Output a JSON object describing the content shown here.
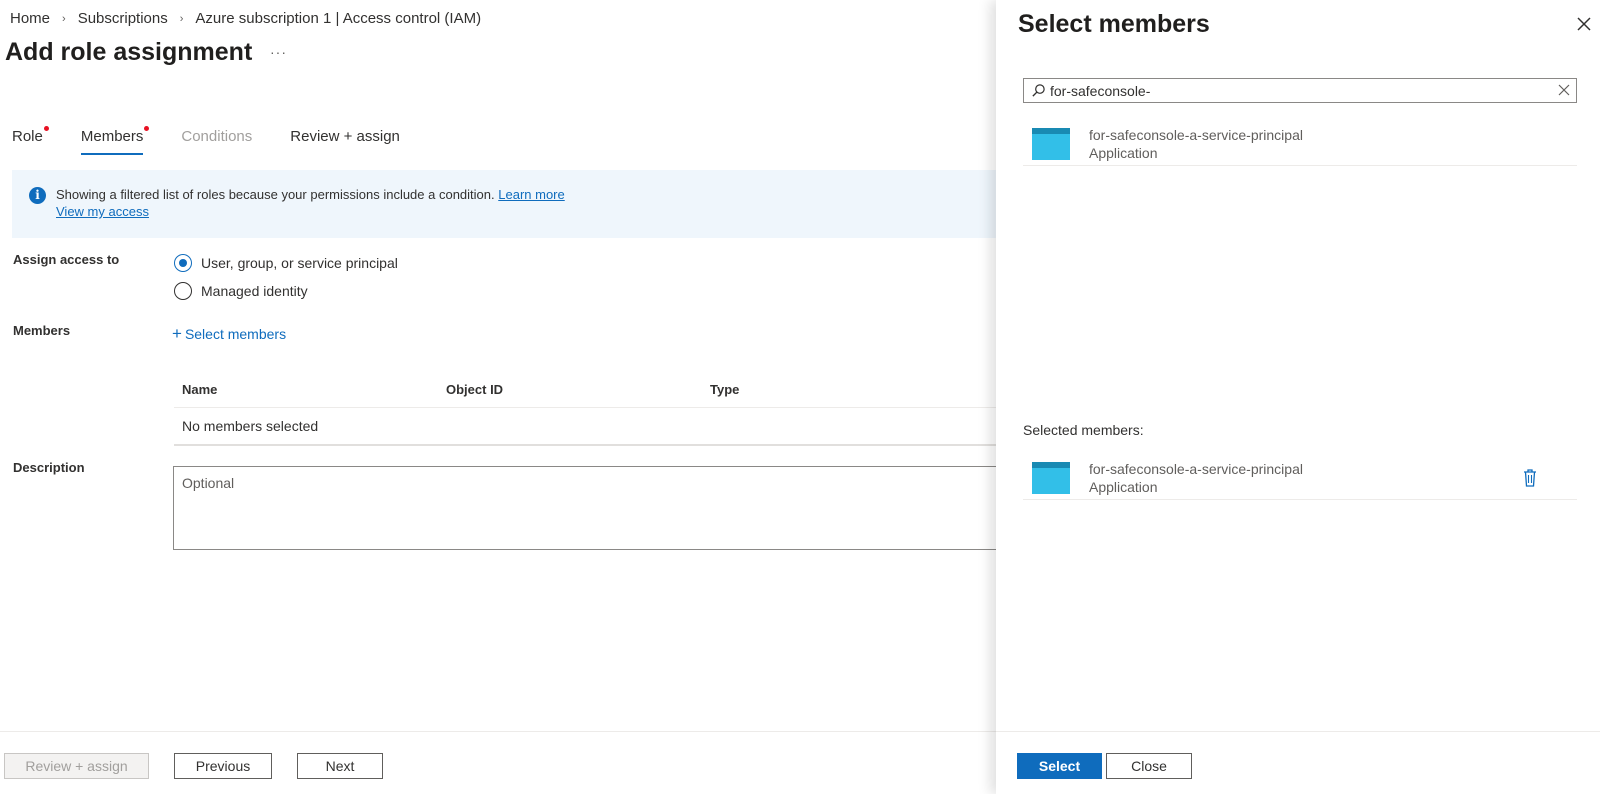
{
  "breadcrumb": {
    "items": [
      "Home",
      "Subscriptions",
      "Azure subscription 1 | Access control (IAM)"
    ],
    "separator": "›"
  },
  "page": {
    "title": "Add role assignment",
    "more": "···"
  },
  "tabs": [
    {
      "label": "Role",
      "required": true,
      "state": "normal"
    },
    {
      "label": "Members",
      "required": true,
      "state": "active"
    },
    {
      "label": "Conditions",
      "required": false,
      "state": "disabled"
    },
    {
      "label": "Review + assign",
      "required": false,
      "state": "normal"
    }
  ],
  "banner": {
    "icon": "info-icon",
    "text": "Showing a filtered list of roles because your permissions include a condition.",
    "learn_more": "Learn more",
    "view_access": "View my access"
  },
  "form": {
    "assign_access_label": "Assign access to",
    "options": [
      {
        "label": "User, group, or service principal",
        "checked": true
      },
      {
        "label": "Managed identity",
        "checked": false
      }
    ],
    "members_label": "Members",
    "select_members_link": "Select members",
    "table": {
      "columns": [
        "Name",
        "Object ID",
        "Type"
      ],
      "empty_text": "No members selected"
    },
    "description_label": "Description",
    "description_placeholder": "Optional"
  },
  "footer": {
    "review_assign": "Review + assign",
    "previous": "Previous",
    "next": "Next"
  },
  "panel": {
    "title": "Select members",
    "search_value": "for-safeconsole-",
    "results": [
      {
        "name": "for-safeconsole-a-service-principal",
        "type": "Application",
        "icon": "application-icon"
      }
    ],
    "selected_label": "Selected members:",
    "selected": [
      {
        "name": "for-safeconsole-a-service-principal",
        "type": "Application",
        "icon": "application-icon"
      }
    ],
    "select_button": "Select",
    "close_button": "Close"
  },
  "colors": {
    "accent": "#0f6cbd",
    "required_dot": "#e81123",
    "banner_bg": "#eff6fc",
    "app_icon": "#32bfe8"
  }
}
